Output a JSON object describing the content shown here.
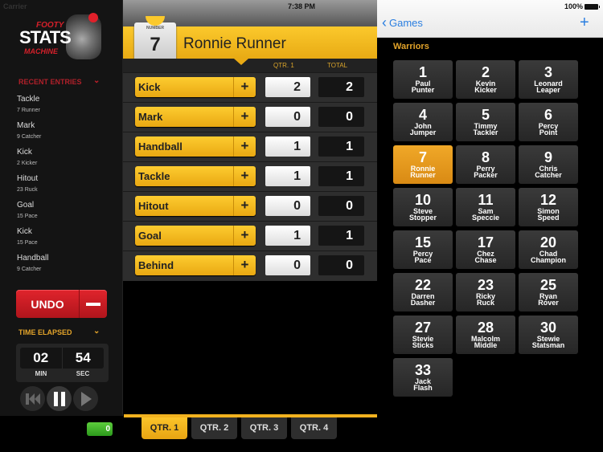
{
  "status": {
    "carrier": "Carrier",
    "time": "7:38 PM",
    "battery": "100%"
  },
  "logo": {
    "line1": "FOOTY",
    "line2": "STATS",
    "line3": "MACHINE"
  },
  "sidebar": {
    "recent_header": "RECENT ENTRIES",
    "entries": [
      {
        "event": "Tackle",
        "player": "7  Runner"
      },
      {
        "event": "Mark",
        "player": "9  Catcher"
      },
      {
        "event": "Kick",
        "player": "2  Kicker"
      },
      {
        "event": "Hitout",
        "player": "23  Ruck"
      },
      {
        "event": "Goal",
        "player": "15  Pace"
      },
      {
        "event": "Kick",
        "player": "15  Pace"
      },
      {
        "event": "Handball",
        "player": "9  Catcher"
      }
    ],
    "undo_label": "UNDO",
    "time_header": "TIME ELAPSED",
    "timer": {
      "min": "02",
      "sec": "54",
      "min_label": "MIN",
      "sec_label": "SEC"
    },
    "score": "0"
  },
  "player": {
    "number_label": "NUMBER",
    "number": "7",
    "name": "Ronnie Runner"
  },
  "columns": {
    "qtr": "QTR. 1",
    "total": "TOTAL"
  },
  "stats": [
    {
      "name": "Kick",
      "qtr": "2",
      "total": "2"
    },
    {
      "name": "Mark",
      "qtr": "0",
      "total": "0"
    },
    {
      "name": "Handball",
      "qtr": "1",
      "total": "1"
    },
    {
      "name": "Tackle",
      "qtr": "1",
      "total": "1"
    },
    {
      "name": "Hitout",
      "qtr": "0",
      "total": "0"
    },
    {
      "name": "Goal",
      "qtr": "1",
      "total": "1"
    },
    {
      "name": "Behind",
      "qtr": "0",
      "total": "0"
    }
  ],
  "plus_label": "+",
  "quarters": [
    {
      "label": "QTR. 1",
      "active": true
    },
    {
      "label": "QTR. 2",
      "active": false
    },
    {
      "label": "QTR. 3",
      "active": false
    },
    {
      "label": "QTR. 4",
      "active": false
    }
  ],
  "nav": {
    "back_label": "Games",
    "add_label": "+"
  },
  "team": "Warriors",
  "players": [
    {
      "num": "1",
      "first": "Paul",
      "last": "Punter"
    },
    {
      "num": "2",
      "first": "Kevin",
      "last": "Kicker"
    },
    {
      "num": "3",
      "first": "Leonard",
      "last": "Leaper"
    },
    {
      "num": "4",
      "first": "John",
      "last": "Jumper"
    },
    {
      "num": "5",
      "first": "Timmy",
      "last": "Tackler"
    },
    {
      "num": "6",
      "first": "Percy",
      "last": "Point"
    },
    {
      "num": "7",
      "first": "Ronnie",
      "last": "Runner",
      "active": true
    },
    {
      "num": "8",
      "first": "Perry",
      "last": "Packer"
    },
    {
      "num": "9",
      "first": "Chris",
      "last": "Catcher"
    },
    {
      "num": "10",
      "first": "Steve",
      "last": "Stopper"
    },
    {
      "num": "11",
      "first": "Sam",
      "last": "Speccie"
    },
    {
      "num": "12",
      "first": "Simon",
      "last": "Speed"
    },
    {
      "num": "15",
      "first": "Percy",
      "last": "Pace"
    },
    {
      "num": "17",
      "first": "Chez",
      "last": "Chase"
    },
    {
      "num": "20",
      "first": "Chad",
      "last": "Champion"
    },
    {
      "num": "22",
      "first": "Darren",
      "last": "Dasher"
    },
    {
      "num": "23",
      "first": "Ricky",
      "last": "Ruck"
    },
    {
      "num": "25",
      "first": "Ryan",
      "last": "Rover"
    },
    {
      "num": "27",
      "first": "Stevie",
      "last": "Sticks"
    },
    {
      "num": "28",
      "first": "Malcolm",
      "last": "Middle"
    },
    {
      "num": "30",
      "first": "Stewie",
      "last": "Statsman"
    },
    {
      "num": "33",
      "first": "Jack",
      "last": "Flash"
    }
  ],
  "colors": {
    "accent": "#f2b21f",
    "undo": "#d4202a",
    "ios_blue": "#2a7ee0"
  }
}
